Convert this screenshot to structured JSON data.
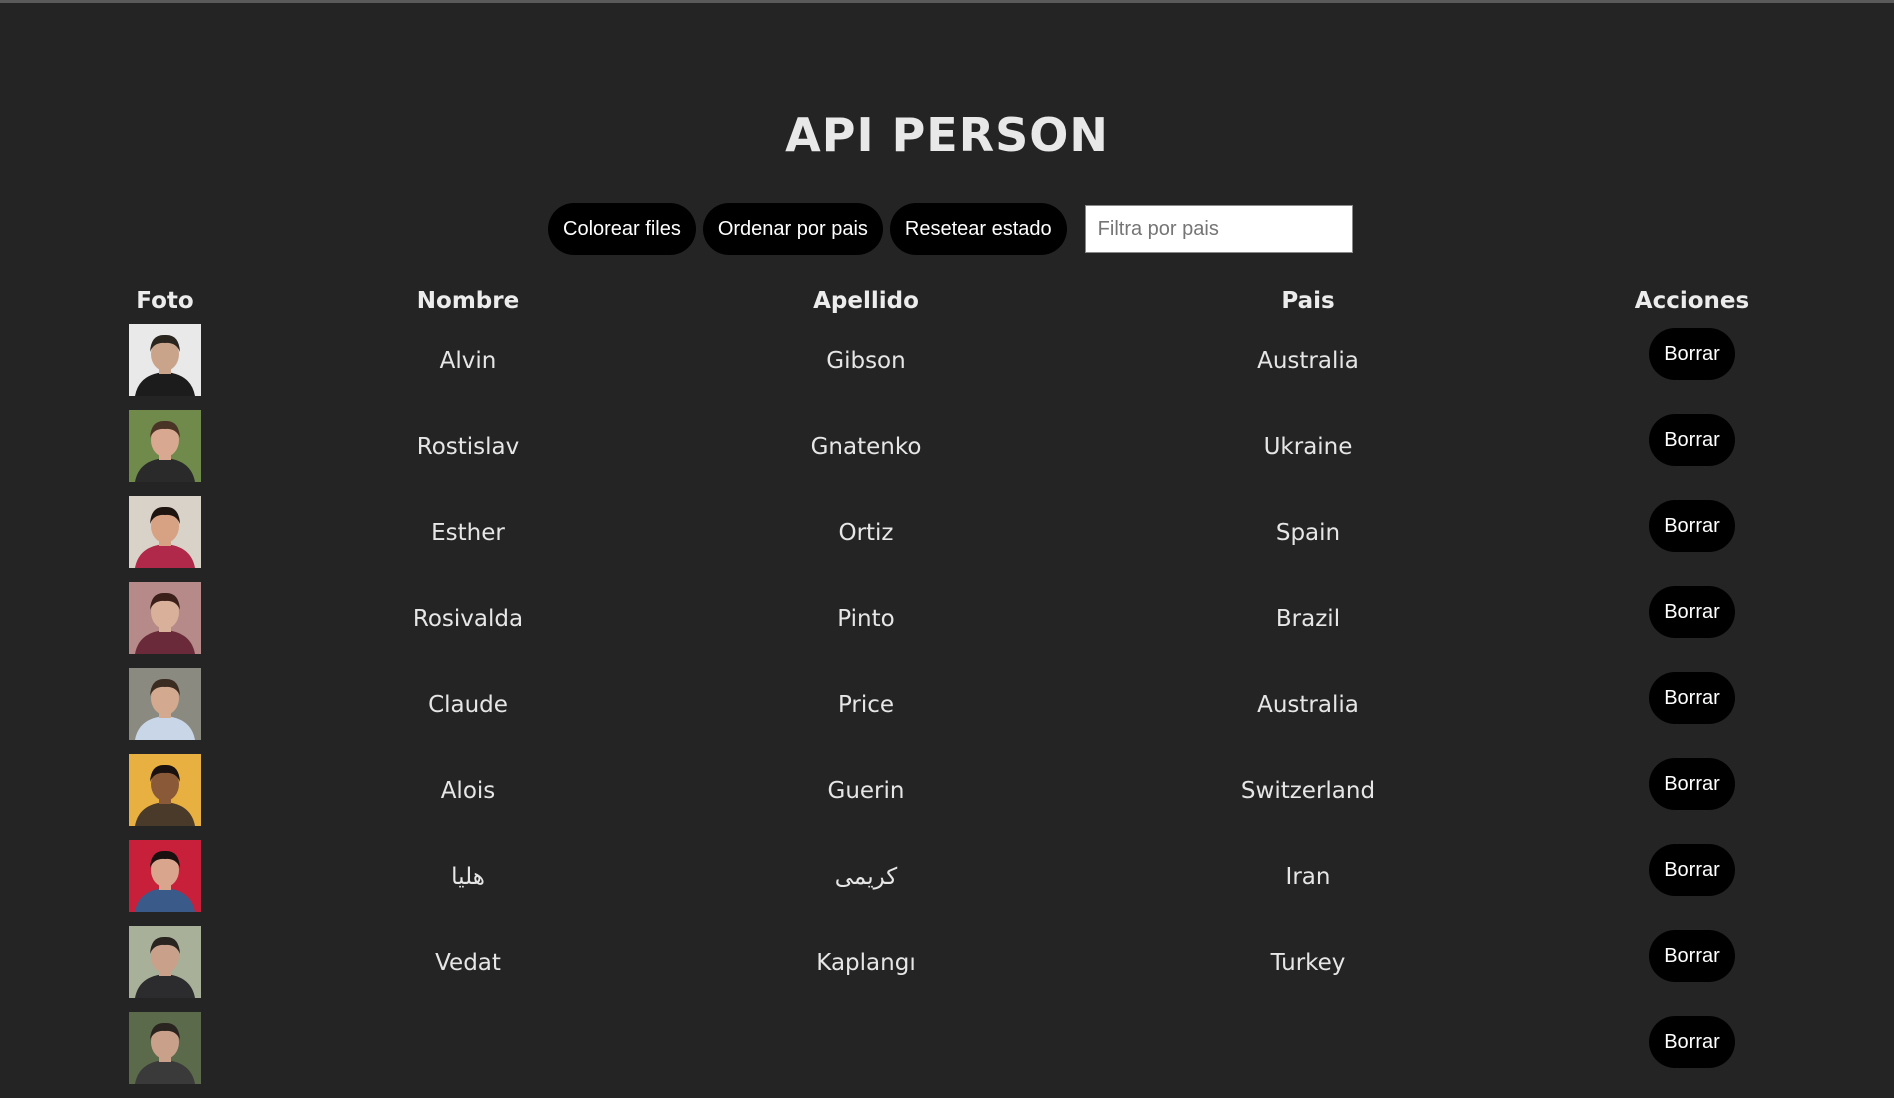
{
  "page": {
    "title": "API PERSON"
  },
  "toolbar": {
    "color_rows_label": "Colorear files",
    "sort_by_country_label": "Ordenar por pais",
    "reset_state_label": "Resetear estado",
    "filter_placeholder": "Filtra por pais"
  },
  "table": {
    "headers": {
      "foto": "Foto",
      "nombre": "Nombre",
      "apellido": "Apellido",
      "pais": "Pais",
      "acciones": "Acciones"
    },
    "delete_label": "Borrar",
    "rows": [
      {
        "first": "Alvin",
        "last": "Gibson",
        "country": "Australia",
        "photo": {
          "bg": "#e9e9e9",
          "skin": "#c9a48a",
          "hair": "#2b2520",
          "shirt": "#1c1c1c"
        }
      },
      {
        "first": "Rostislav",
        "last": "Gnatenko",
        "country": "Ukraine",
        "photo": {
          "bg": "#6f8a4a",
          "skin": "#d8a890",
          "hair": "#4a3426",
          "shirt": "#2a2a2a"
        }
      },
      {
        "first": "Esther",
        "last": "Ortiz",
        "country": "Spain",
        "photo": {
          "bg": "#d9d2c8",
          "skin": "#d6a283",
          "hair": "#1e1410",
          "shirt": "#b0284a"
        }
      },
      {
        "first": "Rosivalda",
        "last": "Pinto",
        "country": "Brazil",
        "photo": {
          "bg": "#b58a88",
          "skin": "#d9b09a",
          "hair": "#3a2018",
          "shirt": "#6a2a3a"
        }
      },
      {
        "first": "Claude",
        "last": "Price",
        "country": "Australia",
        "photo": {
          "bg": "#8a8a80",
          "skin": "#d3a98f",
          "hair": "#3b2c22",
          "shirt": "#c9d6e8"
        }
      },
      {
        "first": "Alois",
        "last": "Guerin",
        "country": "Switzerland",
        "photo": {
          "bg": "#e8b040",
          "skin": "#8a5a38",
          "hair": "#1a1210",
          "shirt": "#4a3a2a"
        }
      },
      {
        "first": "هليا",
        "last": "کریمی",
        "country": "Iran",
        "photo": {
          "bg": "#c8203a",
          "skin": "#d9a58c",
          "hair": "#1a1010",
          "shirt": "#3a5a8a"
        }
      },
      {
        "first": "Vedat",
        "last": "Kaplangı",
        "country": "Turkey",
        "photo": {
          "bg": "#a8b09a",
          "skin": "#c9a08a",
          "hair": "#2a2420",
          "shirt": "#2c2c2e"
        }
      },
      {
        "first": "",
        "last": "",
        "country": "",
        "photo": {
          "bg": "#5a6a4a",
          "skin": "#c9a08a",
          "hair": "#2a2420",
          "shirt": "#3a3a3a"
        }
      }
    ]
  }
}
